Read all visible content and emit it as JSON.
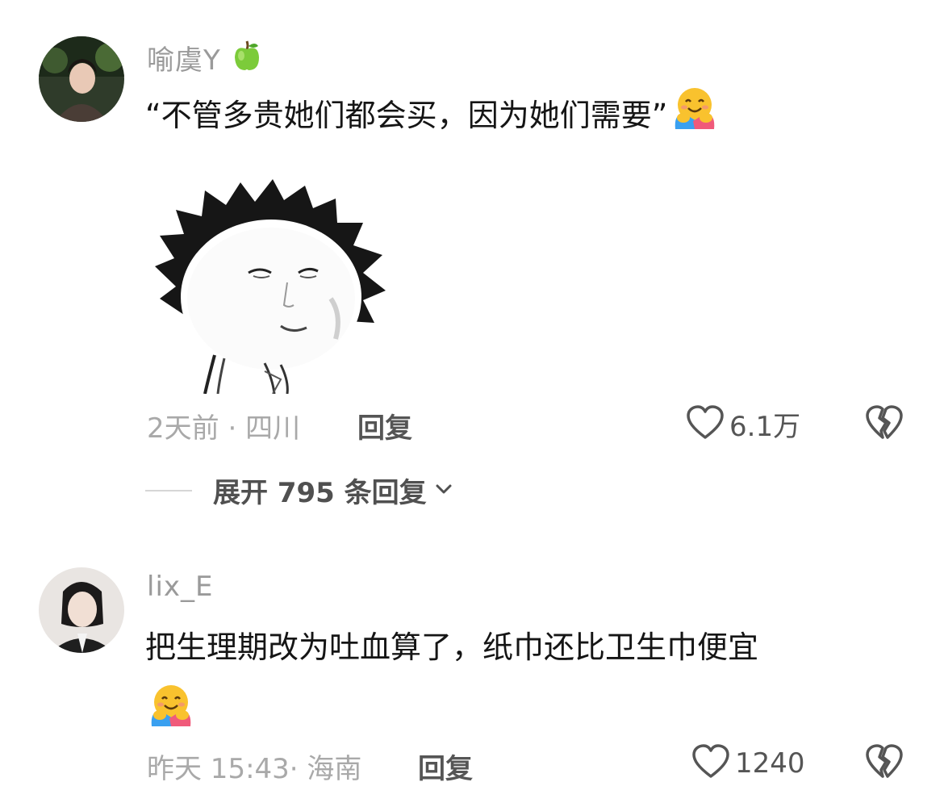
{
  "comments": [
    {
      "username": "喻虞Y",
      "badge_icon": "green-apple-icon",
      "text": "“不管多贵她们都会买，因为她们需要”",
      "text_emoji": "hugging-face-icon",
      "time": "2天前",
      "location": "四川",
      "reply_label": "回复",
      "likes": "6.1万",
      "expand_label": "展开 795 条回复"
    },
    {
      "username": "lix_E",
      "text": "把生理期改为吐血算了，纸巾还比卫生巾便宜",
      "text_emoji": "hugging-face-icon",
      "time": "昨天 15:43",
      "location": "海南",
      "reply_label": "回复",
      "likes": "1240"
    }
  ],
  "colors": {
    "username": "#9a9a9a",
    "meta": "#a9a9a9",
    "text": "#151515"
  }
}
